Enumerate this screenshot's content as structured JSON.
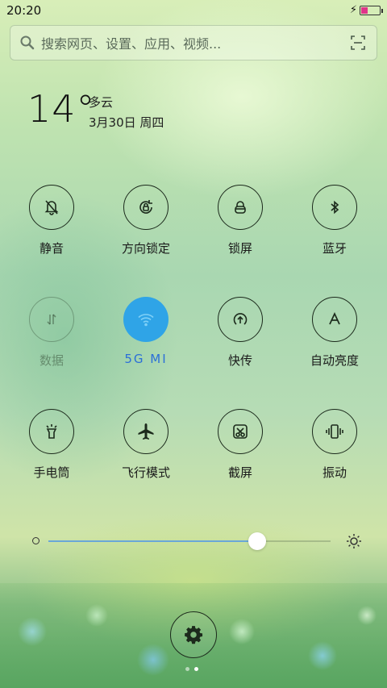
{
  "status": {
    "time": "20:20"
  },
  "search": {
    "placeholder": "搜索网页、设置、应用、视频..."
  },
  "weather": {
    "temperature": "14°",
    "condition": "多云",
    "date": "3月30日 周四"
  },
  "toggles": [
    {
      "label": "静音",
      "icon": "bell-off-icon",
      "state": "off"
    },
    {
      "label": "方向锁定",
      "icon": "rotation-lock-icon",
      "state": "off"
    },
    {
      "label": "锁屏",
      "icon": "lock-icon",
      "state": "off"
    },
    {
      "label": "蓝牙",
      "icon": "bluetooth-icon",
      "state": "off"
    },
    {
      "label": "数据",
      "icon": "mobile-data-icon",
      "state": "disabled"
    },
    {
      "label": "5G   MI",
      "icon": "wifi-icon",
      "state": "on"
    },
    {
      "label": "快传",
      "icon": "quick-share-icon",
      "state": "off"
    },
    {
      "label": "自动亮度",
      "icon": "auto-brightness-icon",
      "state": "off"
    },
    {
      "label": "手电筒",
      "icon": "flashlight-icon",
      "state": "off"
    },
    {
      "label": "飞行模式",
      "icon": "airplane-icon",
      "state": "off"
    },
    {
      "label": "截屏",
      "icon": "screenshot-icon",
      "state": "off"
    },
    {
      "label": "振动",
      "icon": "vibrate-icon",
      "state": "off"
    }
  ],
  "brightness": {
    "level": 0.74
  },
  "pager": {
    "pages": 2,
    "current": 2
  },
  "colors": {
    "accent": "#2fa4e7",
    "battery": "#e0338a",
    "slider": "#6aa7d8"
  }
}
